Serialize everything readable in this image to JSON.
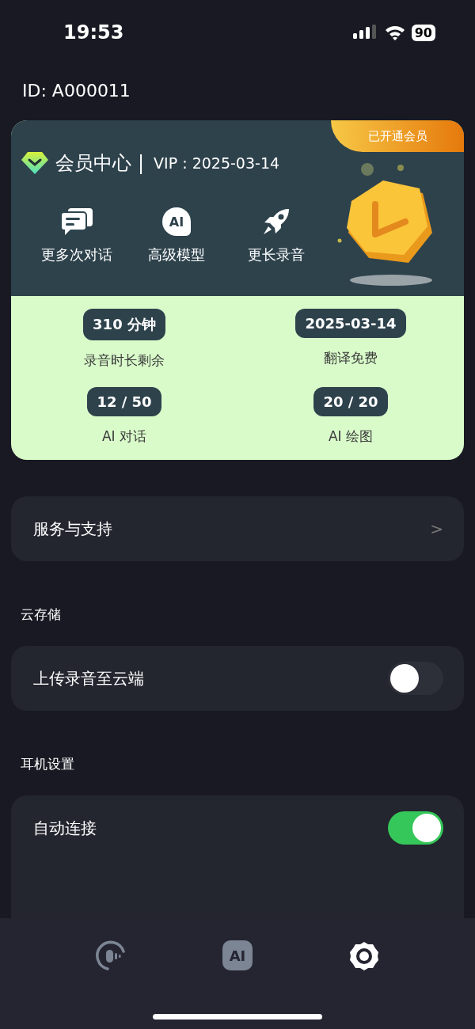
{
  "status_bar": {
    "time": "19:53",
    "battery": "90"
  },
  "account": {
    "id": "ID: A000011"
  },
  "vip_card": {
    "title": "会员中心",
    "divider": "|",
    "expiry": "VIP : 2025-03-14",
    "badge": "已开通会员",
    "features": [
      {
        "kind": "chat",
        "label": "更多次对话"
      },
      {
        "kind": "ai",
        "icon_text": "AI",
        "label": "高级模型"
      },
      {
        "kind": "rocket",
        "label": "更长录音"
      }
    ],
    "stats": [
      {
        "value": "310 分钟",
        "label": "录音时长剩余"
      },
      {
        "value": "2025-03-14",
        "label": "翻译免费"
      },
      {
        "value": "12 / 50",
        "label": "AI 对话"
      },
      {
        "value": "20 / 20",
        "label": "AI 绘图"
      }
    ]
  },
  "sections": [
    {
      "items": [
        {
          "kind": "link",
          "label": "服务与支持",
          "chevron": ">"
        }
      ]
    },
    {
      "title": "云存储",
      "items": [
        {
          "kind": "toggle",
          "label": "上传录音至云端",
          "on": false
        }
      ]
    },
    {
      "title": "耳机设置",
      "items": [
        {
          "kind": "toggle",
          "label": "自动连接",
          "on": true
        },
        {
          "kind": "spacer"
        }
      ]
    }
  ],
  "tab_bar": [
    {
      "kind": "record",
      "selected": false
    },
    {
      "kind": "ai",
      "icon_text": "AI",
      "selected": false
    },
    {
      "kind": "settings",
      "selected": true
    }
  ]
}
